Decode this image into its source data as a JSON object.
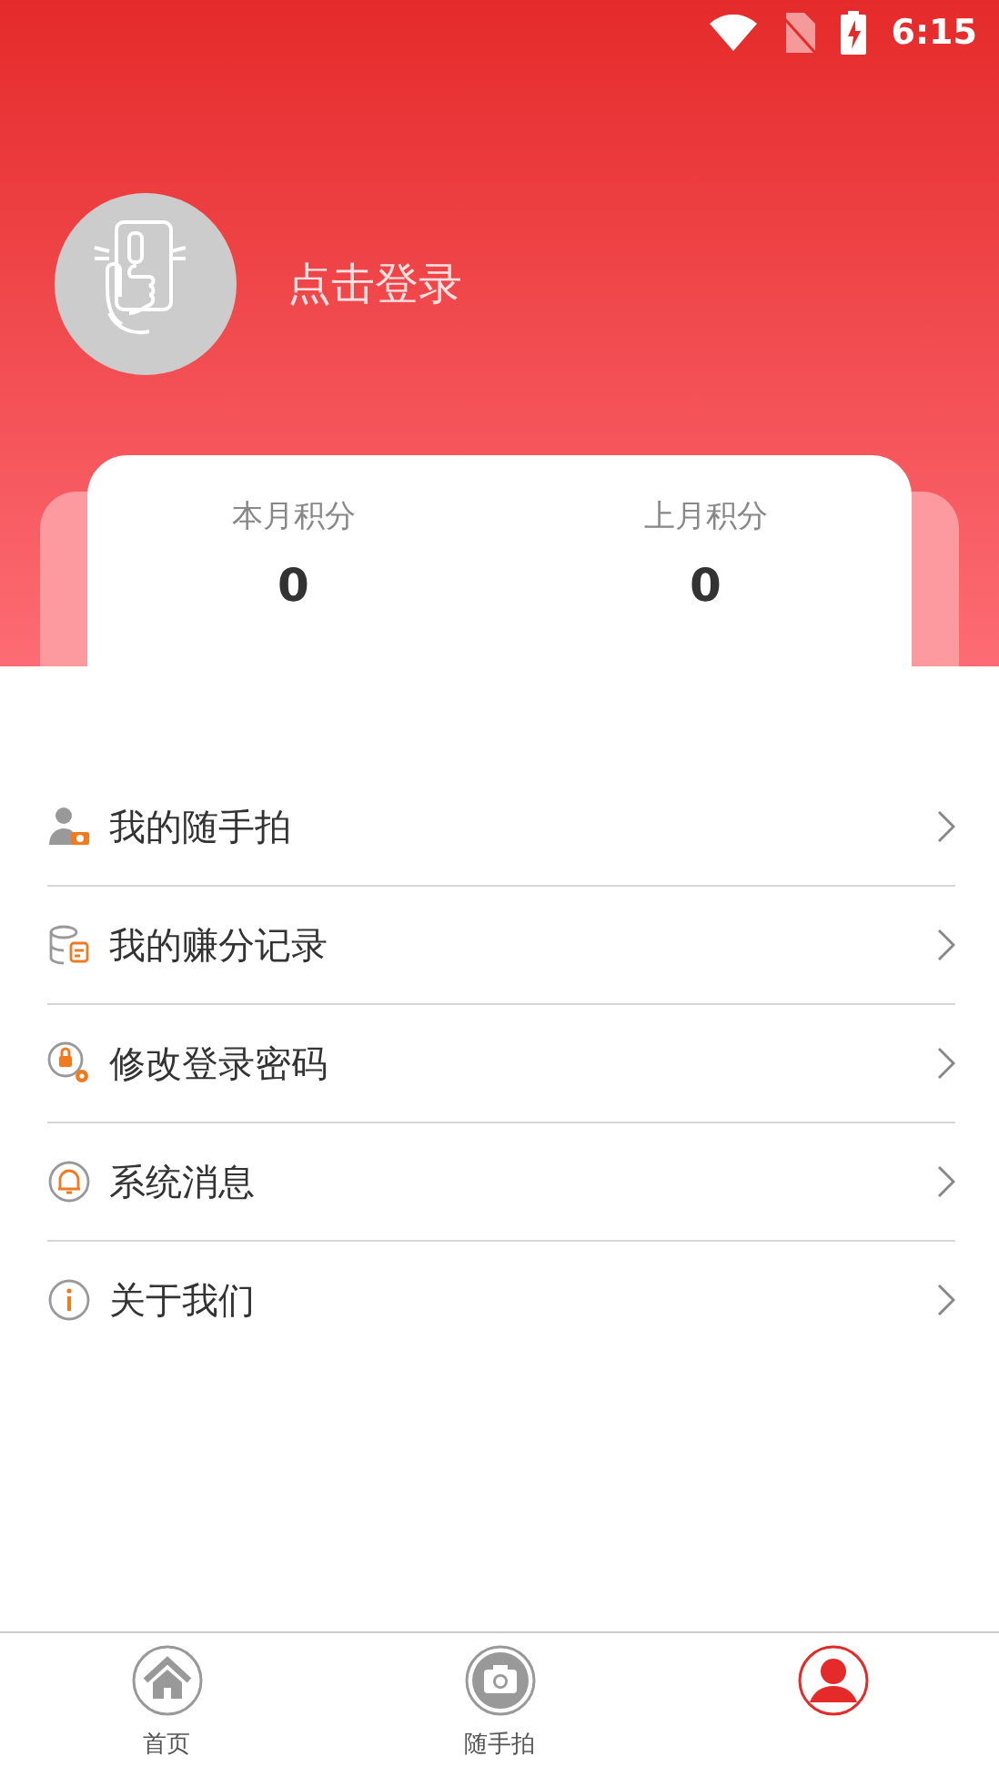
{
  "status_bar": {
    "time": "6:15"
  },
  "profile": {
    "login_label": "点击登录"
  },
  "points": [
    {
      "label": "本月积分",
      "value": "0"
    },
    {
      "label": "上月积分",
      "value": "0"
    }
  ],
  "menu": [
    {
      "kind": "photos",
      "label": "我的随手拍"
    },
    {
      "kind": "records",
      "label": "我的赚分记录"
    },
    {
      "kind": "password",
      "label": "修改登录密码"
    },
    {
      "kind": "messages",
      "label": "系统消息"
    },
    {
      "kind": "about",
      "label": "关于我们"
    }
  ],
  "tabs": [
    {
      "kind": "home",
      "label": "首页",
      "selected": false
    },
    {
      "kind": "camera",
      "label": "随手拍",
      "selected": false
    },
    {
      "kind": "profile",
      "selected": true
    }
  ]
}
